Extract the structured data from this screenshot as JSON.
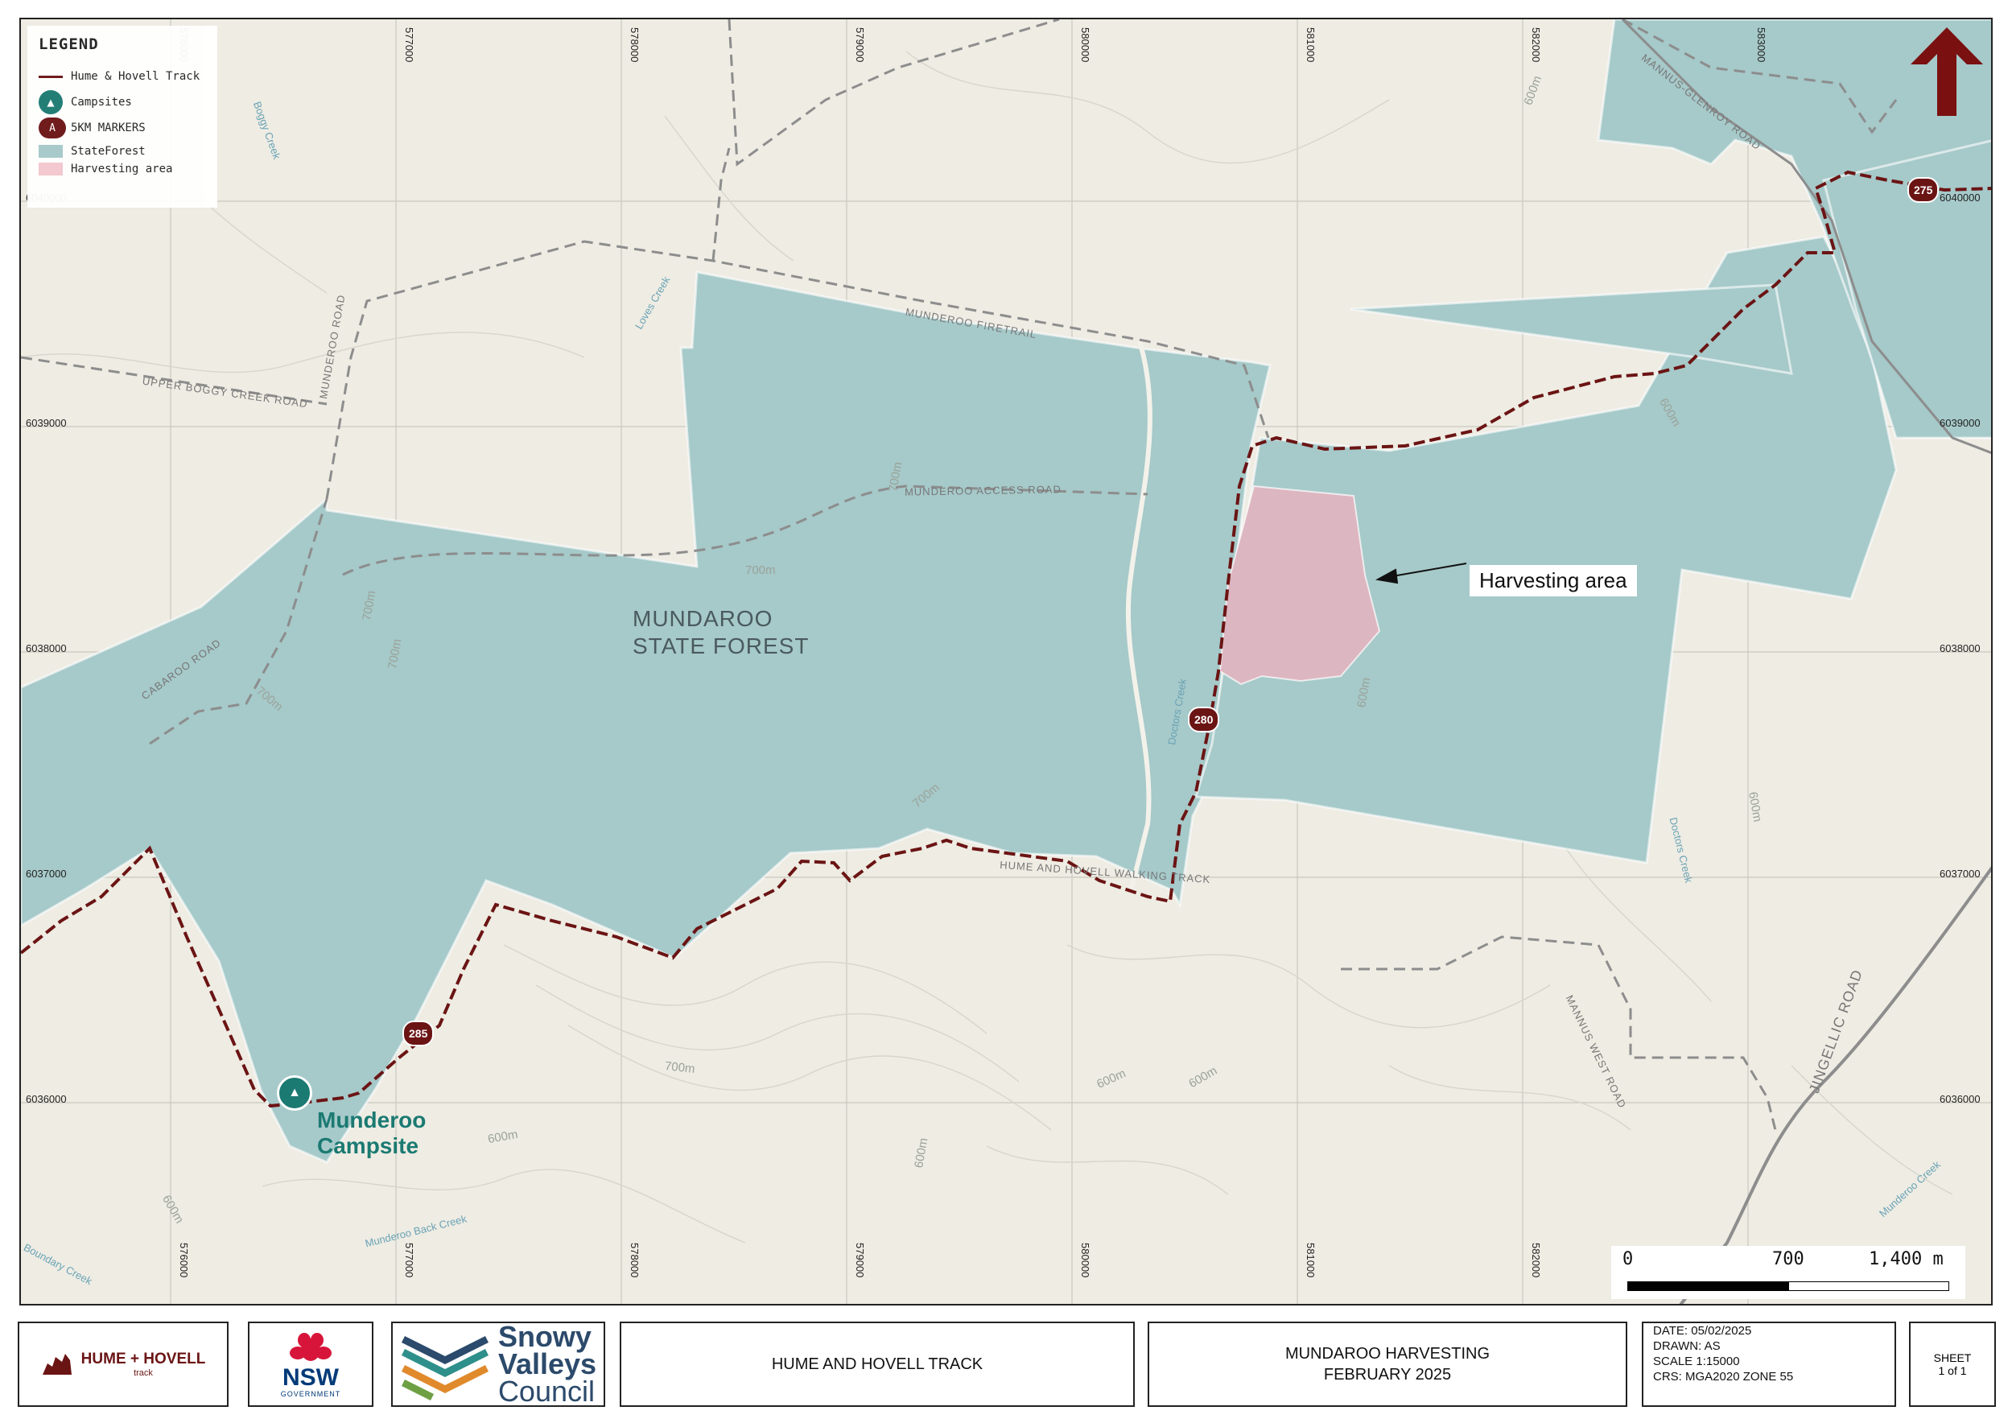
{
  "legend": {
    "title": "LEGEND",
    "items": [
      {
        "label": "Hume & Hovell Track"
      },
      {
        "label": "Campsites",
        "icon": "campsite-icon"
      },
      {
        "label": "5KM MARKERS",
        "icon_text": "A"
      },
      {
        "label": "StateForest",
        "color": "#a6c9c9"
      },
      {
        "label": "Harvesting area",
        "color": "#f4c7cf"
      }
    ]
  },
  "map": {
    "colors": {
      "background": "#eeece3",
      "forest": "#a6c9c9",
      "harvest": "#dcb6c0",
      "track": "#6b1414",
      "campsite": "#1b7a72"
    },
    "forest_label": [
      "MUNDAROO",
      "STATE FOREST"
    ],
    "harvest_label": "Harvesting area",
    "campsite_label": [
      "Munderoo",
      "Campsite"
    ],
    "markers": [
      "275",
      "280",
      "285"
    ],
    "roads": [
      "UPPER BOGGY CREEK ROAD",
      "MUNDEROO ROAD",
      "MUNDEROO ACCESS ROAD",
      "MUNDEROO FIRETRAIL",
      "CABAROO ROAD",
      "MANNUS-GLENROY ROAD",
      "MANNUS WEST ROAD",
      "JINGELLIC ROAD",
      "HUME AND HOVELL WALKING TRACK"
    ],
    "creeks": [
      "Boggy Creek",
      "Loves Creek",
      "Doctors Creek",
      "Munderoo Back Creek",
      "Boundary Creek",
      "Munderoo Creek"
    ],
    "contours": [
      "700m",
      "700m",
      "700m",
      "700m",
      "700m",
      "700m",
      "700m",
      "600m",
      "600m",
      "600m",
      "600m",
      "600m",
      "600m",
      "600m",
      "600m",
      "600m"
    ],
    "eastings": [
      "576000",
      "577000",
      "578000",
      "579000",
      "580000",
      "581000",
      "582000",
      "583000"
    ],
    "northings": [
      "6040000",
      "6039000",
      "6038000",
      "6037000",
      "6036000"
    ],
    "scale": {
      "start": "0",
      "mid": "700",
      "end": "1,400  m"
    }
  },
  "titleblock": {
    "hh_logo": "HUME + HOVELL",
    "hh_sub": "track",
    "nsw": "NSW",
    "nsw_gov": "GOVERNMENT",
    "sv": [
      "Snowy",
      "Valleys",
      "Council"
    ],
    "project": "HUME AND HOVELL TRACK",
    "title": [
      "MUNDAROO HARVESTING",
      "FEBRUARY 2025"
    ],
    "info": [
      "DATE: 05/02/2025",
      "DRAWN: AS",
      "SCALE 1:15000",
      "CRS: MGA2020 ZONE 55"
    ],
    "sheet": [
      "SHEET",
      "1 of 1"
    ]
  }
}
